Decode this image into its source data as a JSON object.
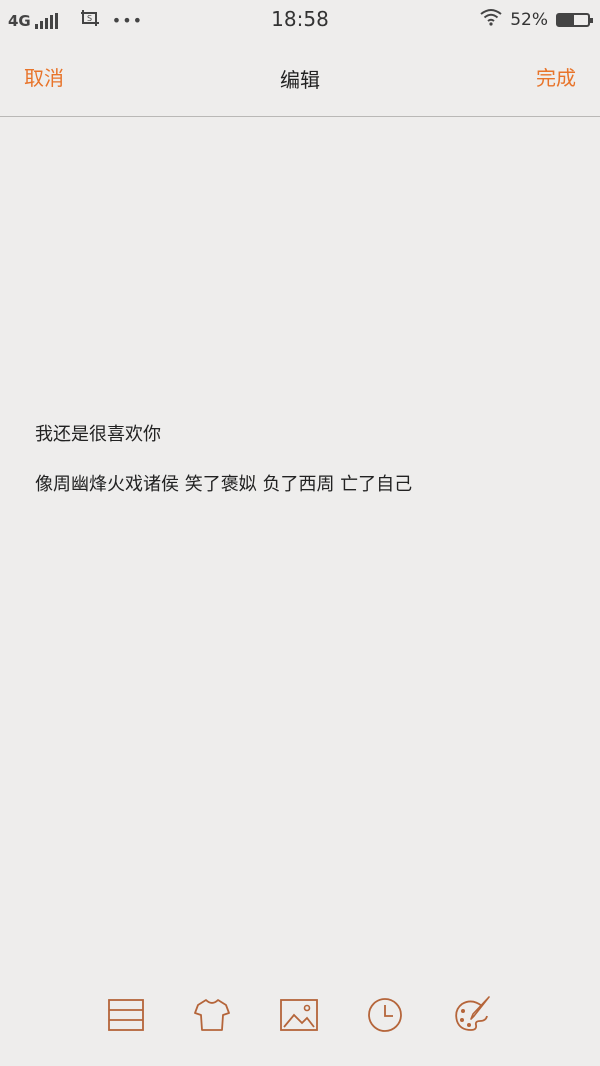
{
  "status_bar": {
    "network": "4G",
    "time": "18:58",
    "battery_percent": "52%",
    "battery_level": 0.52
  },
  "nav": {
    "cancel_label": "取消",
    "title": "编辑",
    "done_label": "完成"
  },
  "note": {
    "lines": [
      "我还是很喜欢你",
      "像周幽烽火戏诸侯 笑了褒姒 负了西周 亡了自己"
    ]
  },
  "toolbar": {
    "icons": [
      "list-icon",
      "shirt-icon",
      "image-icon",
      "clock-icon",
      "palette-icon"
    ]
  },
  "colors": {
    "accent": "#e8742a",
    "icon": "#b5653a",
    "background": "#eeedec",
    "text": "#222222"
  }
}
